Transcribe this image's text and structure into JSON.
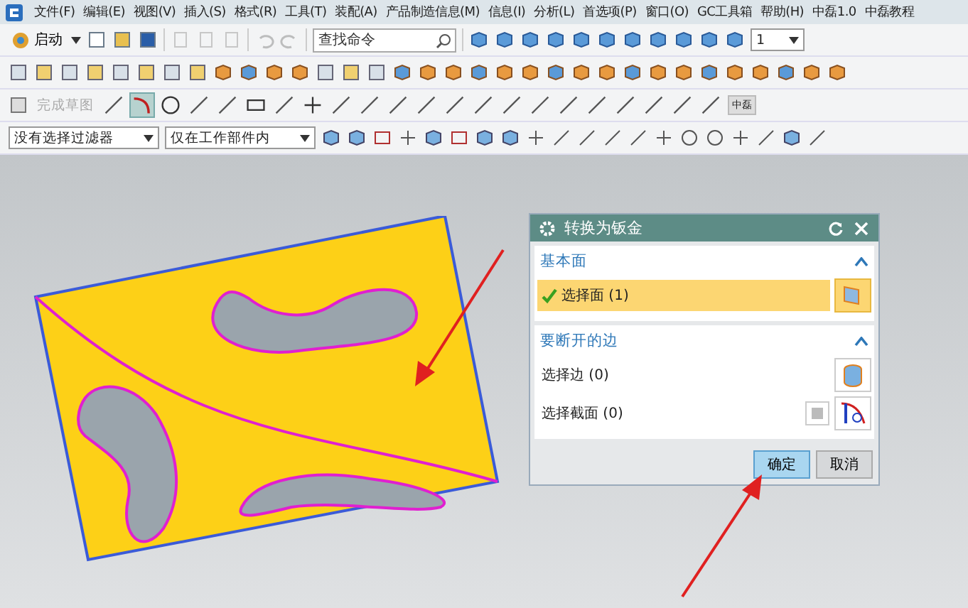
{
  "menu_bar": {
    "items": [
      "文件(F)",
      "编辑(E)",
      "视图(V)",
      "插入(S)",
      "格式(R)",
      "工具(T)",
      "装配(A)",
      "产品制造信息(M)",
      "信息(I)",
      "分析(L)",
      "首选项(P)",
      "窗口(O)",
      "GC工具箱",
      "帮助(H)",
      "中磊1.0",
      "中磊教程"
    ]
  },
  "toolbar": {
    "start_label": "启动",
    "search": {
      "placeholder": "查找命令"
    },
    "layer_value": "1",
    "finish_sketch": {
      "label": "完成草图",
      "disabled": true
    },
    "sketch_tag": "中磊",
    "selection_filter": "没有选择过滤器",
    "scope_filter": "仅在工作部件内"
  },
  "dialog": {
    "title": "转换为钣金",
    "sections": [
      {
        "title": "基本面",
        "expanded": true,
        "rows": [
          {
            "label": "选择面 (1)",
            "selected": true,
            "done": true,
            "kind": "face"
          }
        ]
      },
      {
        "title": "要断开的边",
        "expanded": true,
        "rows": [
          {
            "label": "选择边 (0)",
            "selected": false,
            "done": false,
            "kind": "edge"
          },
          {
            "label": "选择截面 (0)",
            "selected": false,
            "done": false,
            "kind": "section"
          }
        ]
      }
    ],
    "buttons": [
      {
        "label": "确定",
        "default": true
      },
      {
        "label": "取消",
        "default": false
      }
    ]
  }
}
